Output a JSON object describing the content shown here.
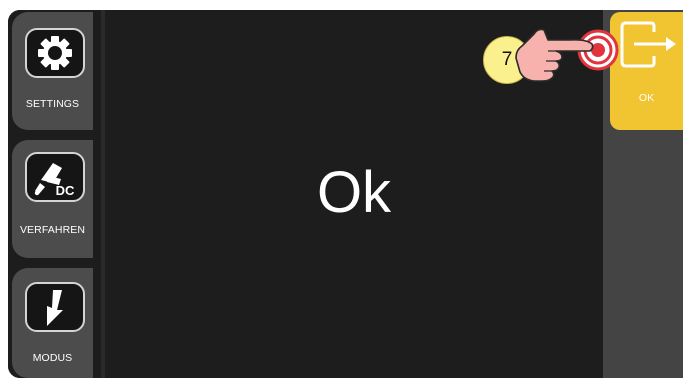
{
  "sidebar": {
    "items": [
      {
        "label": "SETTINGS",
        "icon": "gear-icon"
      },
      {
        "label": "VERFAHREN",
        "icon": "dc-torch-icon",
        "icon_text": "DC"
      },
      {
        "label": "MODUS",
        "icon": "arrow-down-icon"
      }
    ]
  },
  "main": {
    "text": "Ok"
  },
  "right_panel": {
    "ok_label": "OK",
    "ok_icon": "exit-arrow-icon"
  },
  "annotation": {
    "step_number": "7",
    "pointer_icon": "hand-pointer-icon"
  },
  "colors": {
    "background": "#1d1d1d",
    "sidebar_button": "#4c4c4c",
    "right_panel": "#444444",
    "accent_yellow": "#f1c531",
    "badge_yellow": "#fbf08e",
    "touch_red": "#e2343d"
  }
}
